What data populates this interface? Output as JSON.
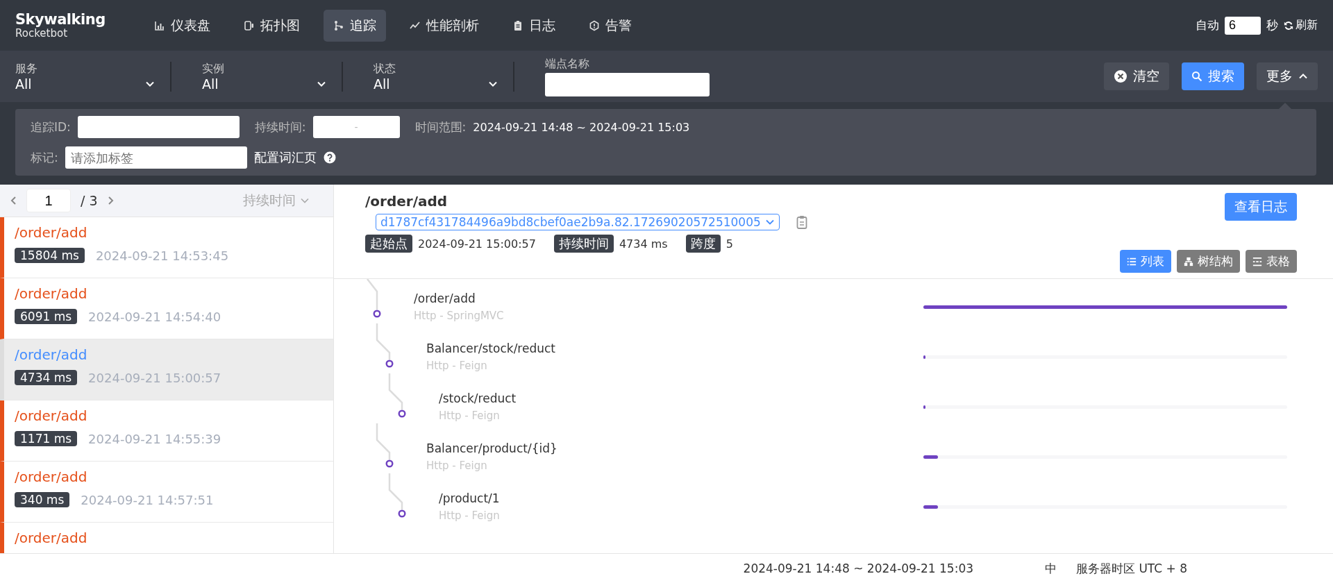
{
  "brand": {
    "name": "Skywalking",
    "sub": "Rocketbot"
  },
  "nav": [
    {
      "label": "仪表盘",
      "selected": false
    },
    {
      "label": "拓扑图",
      "selected": false
    },
    {
      "label": "追踪",
      "selected": true
    },
    {
      "label": "性能剖析",
      "selected": false
    },
    {
      "label": "日志",
      "selected": false
    },
    {
      "label": "告警",
      "selected": false
    }
  ],
  "auto_refresh": {
    "label": "自动",
    "value": "6",
    "unit": "秒",
    "refresh": "刷新"
  },
  "filters": [
    {
      "label": "服务",
      "value": "All",
      "kind": "select"
    },
    {
      "label": "实例",
      "value": "All",
      "kind": "select"
    },
    {
      "label": "状态",
      "value": "All",
      "kind": "select"
    },
    {
      "label": "端点名称",
      "kind": "input"
    }
  ],
  "actions": [
    {
      "label": "清空",
      "kind": "clear"
    },
    {
      "label": "搜索",
      "kind": "search"
    },
    {
      "label": "更多",
      "kind": "more",
      "expanded": true
    }
  ],
  "advanced": {
    "trace_id_label": "追踪ID:",
    "duration_label": "持续时间:",
    "duration_sep": "-",
    "time_range_label": "时间范围:",
    "time_range": "2024-09-21 14:48 ~ 2024-09-21 15:03",
    "tags_label": "标记:",
    "tags_placeholder": "请添加标签",
    "vocab_link": "配置词汇页"
  },
  "trace_list": {
    "page": "1",
    "total": "/ 3",
    "sort": "持续时间",
    "items": [
      {
        "endpoint": "/order/add",
        "duration": "15804 ms",
        "time": "2024-09-21 14:53:45",
        "error": true,
        "selected": false
      },
      {
        "endpoint": "/order/add",
        "duration": "6091 ms",
        "time": "2024-09-21 14:54:40",
        "error": true,
        "selected": false
      },
      {
        "endpoint": "/order/add",
        "duration": "4734 ms",
        "time": "2024-09-21 15:00:57",
        "error": false,
        "selected": true
      },
      {
        "endpoint": "/order/add",
        "duration": "1171 ms",
        "time": "2024-09-21 14:55:39",
        "error": true,
        "selected": false
      },
      {
        "endpoint": "/order/add",
        "duration": "340 ms",
        "time": "2024-09-21 14:57:51",
        "error": true,
        "selected": false
      },
      {
        "endpoint": "/order/add",
        "error": true,
        "selected": false
      }
    ]
  },
  "trace": {
    "endpoint": "/order/add",
    "trace_id": "d1787cf431784496a9bd8cbef0ae2b9a.82.17269020572510005",
    "view_logs": "查看日志",
    "tags": [
      {
        "label": "起始点",
        "value": "2024-09-21 15:00:57"
      },
      {
        "label": "持续时间",
        "value": "4734 ms"
      },
      {
        "label": "跨度",
        "value": "5"
      }
    ],
    "views": [
      {
        "label": "列表",
        "selected": true
      },
      {
        "label": "树结构",
        "selected": false
      },
      {
        "label": "表格",
        "selected": false
      }
    ],
    "spans": [
      {
        "name": "/order/add",
        "type": "Http - SpringMVC",
        "level": 1,
        "children": [
          {
            "name": "Balancer/stock/reduct",
            "type": "Http - Feign",
            "level": 0.005,
            "children": [
              {
                "name": "/stock/reduct",
                "type": "Http - Feign",
                "level": 0.005
              }
            ]
          },
          {
            "name": "Balancer/product/{id}",
            "type": "Http - Feign",
            "level": 0.04,
            "children": [
              {
                "name": "/product/1",
                "type": "Http - Feign",
                "level": 0.04
              }
            ]
          }
        ]
      }
    ]
  },
  "status_bar": {
    "time_range": "2024-09-21 14:48 ~ 2024-09-21 15:03",
    "lang": "中",
    "timezone": "服务器时区 UTC + 8"
  }
}
